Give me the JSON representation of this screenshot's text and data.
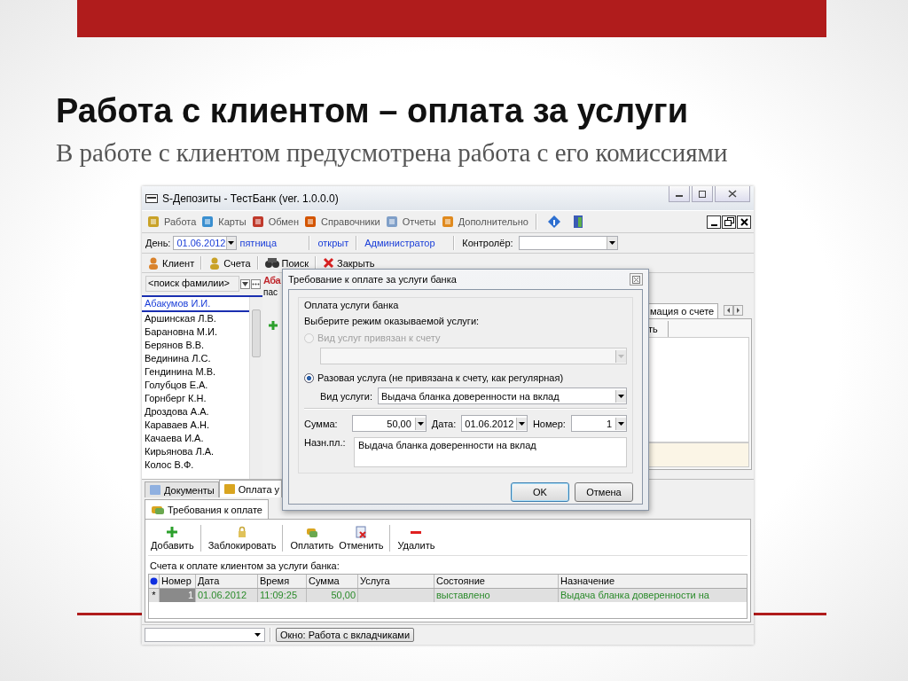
{
  "slide": {
    "title": "Работа с клиентом – оплата за услуги",
    "subtitle": "В работе с клиентом предусмотрена работа с его комиссиями"
  },
  "window": {
    "title": "S-Депозиты - ТестБанк (ver. 1.0.0.0)"
  },
  "menu": [
    {
      "label": "Работа",
      "kind": "work"
    },
    {
      "label": "Карты",
      "kind": "cards"
    },
    {
      "label": "Обмен",
      "kind": "exchange"
    },
    {
      "label": "Справочники",
      "kind": "books"
    },
    {
      "label": "Отчеты",
      "kind": "reports"
    },
    {
      "label": "Дополнительно",
      "kind": "extra"
    }
  ],
  "day_bar": {
    "day_label": "День:",
    "date": "01.06.2012",
    "weekday": "пятница",
    "status": "открыт",
    "user": "Администратор",
    "controller_label": "Контролёр:"
  },
  "toolbar": [
    {
      "label": "Клиент",
      "kind": "client"
    },
    {
      "label": "Счета",
      "kind": "accounts"
    },
    {
      "label": "Поиск",
      "kind": "search"
    },
    {
      "label": "Закрыть",
      "kind": "close"
    }
  ],
  "client_search": {
    "placeholder": "<поиск фамилии>"
  },
  "clients": [
    {
      "name": "Абакумов И.И.",
      "selected": true
    },
    {
      "name": "Аршинская Л.В.",
      "selected": false
    },
    {
      "name": "Барановна М.И.",
      "selected": false
    },
    {
      "name": "Берянов В.В.",
      "selected": false
    },
    {
      "name": "Вединина Л.С.",
      "selected": false
    },
    {
      "name": "Гендинина М.В.",
      "selected": false
    },
    {
      "name": "Голубцов Е.А.",
      "selected": false
    },
    {
      "name": "Горнберг К.Н.",
      "selected": false
    },
    {
      "name": "Дроздова А.А.",
      "selected": false
    },
    {
      "name": "Караваев А.Н.",
      "selected": false
    },
    {
      "name": "Качаева И.А.",
      "selected": false
    },
    {
      "name": "Кирьянова Л.А.",
      "selected": false
    },
    {
      "name": "Колос В.Ф.",
      "selected": false
    }
  ],
  "client_panel": {
    "name": "Аба",
    "line_2": "пас",
    "tab": "мация о счете",
    "column_text": "ть"
  },
  "bottom_tabs": [
    {
      "label": "Документы",
      "selected": false
    },
    {
      "label": "Оплата у",
      "selected": true
    }
  ],
  "sub_tab": "Требования к оплате",
  "actions": [
    {
      "label": "Добавить",
      "kind": "add"
    },
    {
      "label": "Заблокировать",
      "kind": "lock"
    },
    {
      "label": "Оплатить",
      "kind": "pay"
    },
    {
      "label": "Отменить",
      "kind": "cancel"
    },
    {
      "label": "Удалить",
      "kind": "delete"
    }
  ],
  "grid": {
    "caption": "Счета к оплате клиентом за услуги банка:",
    "columns": [
      "Номер",
      "Дата",
      "Время",
      "Сумма",
      "Услуга",
      "Состояние",
      "Назначение"
    ],
    "rows": [
      {
        "marker": "*",
        "number": "1",
        "date": "01.06.2012",
        "time": "11:09:25",
        "sum": "50,00",
        "status": "выставлено",
        "purpose": "Выдача бланка доверенности на",
        "selected": true
      }
    ]
  },
  "status_bar": {
    "window_button": "Окно: Работа с вкладчиками"
  },
  "dialog": {
    "title": "Требование к оплате за услуги банка",
    "group": "Оплата услуги банка",
    "prompt": "Выберите режим оказываемой услуги:",
    "modes": [
      {
        "label": "Вид услуг привязан к счету",
        "selected": false,
        "disabled": true
      },
      {
        "label": "Разовая услуга (не привязана к счету, как регулярная)",
        "selected": true,
        "disabled": false
      }
    ],
    "service_label": "Вид услуги:",
    "service": "Выдача бланка доверенности на вклад",
    "sum_label": "Сумма:",
    "sum": "50,00",
    "date_label": "Дата:",
    "date": "01.06.2012",
    "number_label": "Номер:",
    "number": "1",
    "purpose_label": "Назн.пл.:",
    "purpose": "Выдача бланка доверенности на вклад",
    "buttons": [
      {
        "label": "OK",
        "default": true
      },
      {
        "label": "Отмена",
        "default": false
      }
    ]
  }
}
